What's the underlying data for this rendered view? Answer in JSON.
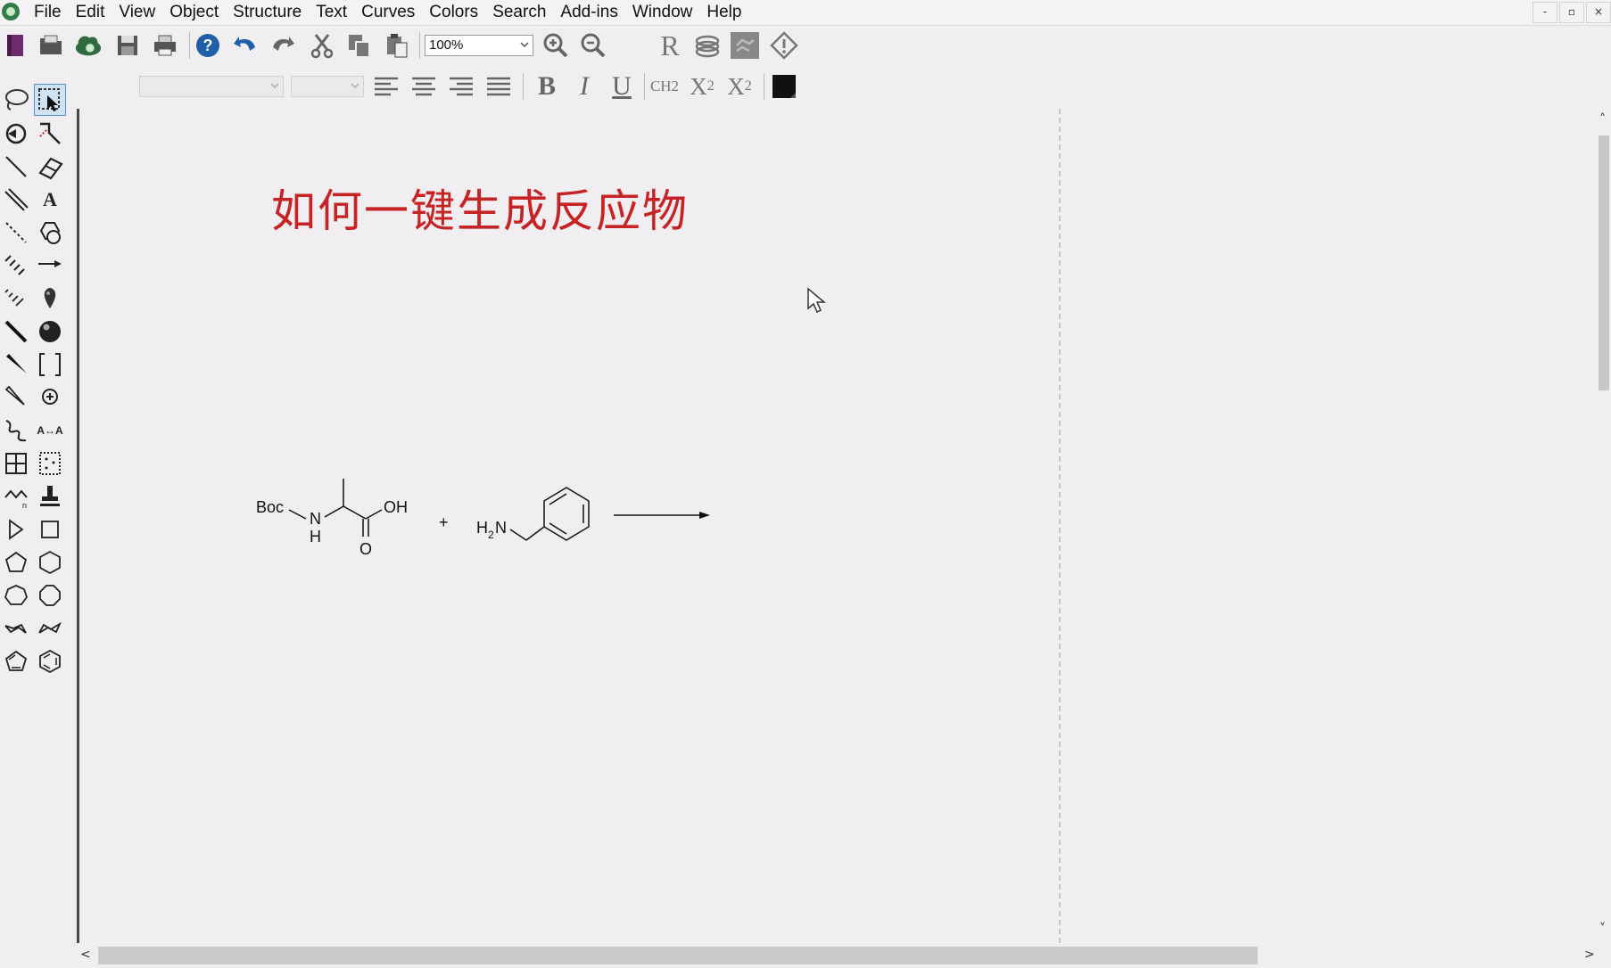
{
  "menubar": {
    "app_icon": "chemdraw-logo-icon",
    "items": [
      "File",
      "Edit",
      "View",
      "Object",
      "Structure",
      "Text",
      "Curves",
      "Colors",
      "Search",
      "Add-ins",
      "Window",
      "Help"
    ],
    "window_controls": [
      "-",
      "▫",
      "×"
    ]
  },
  "toolbar1": {
    "zoom_value": "100%",
    "buttons": [
      "new-document",
      "open",
      "open-online",
      "save",
      "print",
      "help",
      "undo",
      "redo",
      "cut",
      "copy",
      "paste",
      "zoom-in",
      "zoom-out",
      "rgroup",
      "stack",
      "structure-cleanup",
      "check-structure"
    ]
  },
  "toolbar2": {
    "font_name": "",
    "font_size": "",
    "bold_label": "B",
    "italic_label": "I",
    "underline_label": "U",
    "formula_label": "CH2",
    "subscript_label": "X",
    "subscript_digit": "2",
    "superscript_label": "X",
    "superscript_digit": "2",
    "color_value": "#111111"
  },
  "palette": {
    "text_tool_label": "A",
    "atom_map_label": "A↔A",
    "tools": [
      "lasso",
      "marquee",
      "structure-perspective",
      "mass-fragmentation",
      "solid-bond",
      "eraser",
      "multiple-bond",
      "text",
      "dashed-bond",
      "template",
      "hashed-bond",
      "arrow",
      "hashed-wedge",
      "orbital",
      "bold-bond",
      "drawing-element",
      "wedge-bond",
      "bracket",
      "wedged-hash-bond",
      "chemical-symbol",
      "wavy-bond",
      "atom-map",
      "table",
      "query",
      "acyclic-chain",
      "stamp",
      "triangle",
      "square",
      "pentagon",
      "hexagon",
      "heptagon",
      "octagon",
      "cyclohexane-chair-1",
      "cyclohexane-chair-2",
      "cyclopentadiene",
      "benzene"
    ]
  },
  "document": {
    "title": "如何一键生成反应物",
    "reactant1_boc": "Boc",
    "reactant1_n": "N",
    "reactant1_h": "H",
    "reactant1_oh": "OH",
    "reactant1_o": "O",
    "plus": "+",
    "reactant2_h": "H",
    "reactant2_sub": "2",
    "reactant2_n": "N"
  },
  "colors": {
    "title": "#c62424",
    "canvas": "#f0eef0",
    "blue_icon": "#1e5fa8"
  }
}
